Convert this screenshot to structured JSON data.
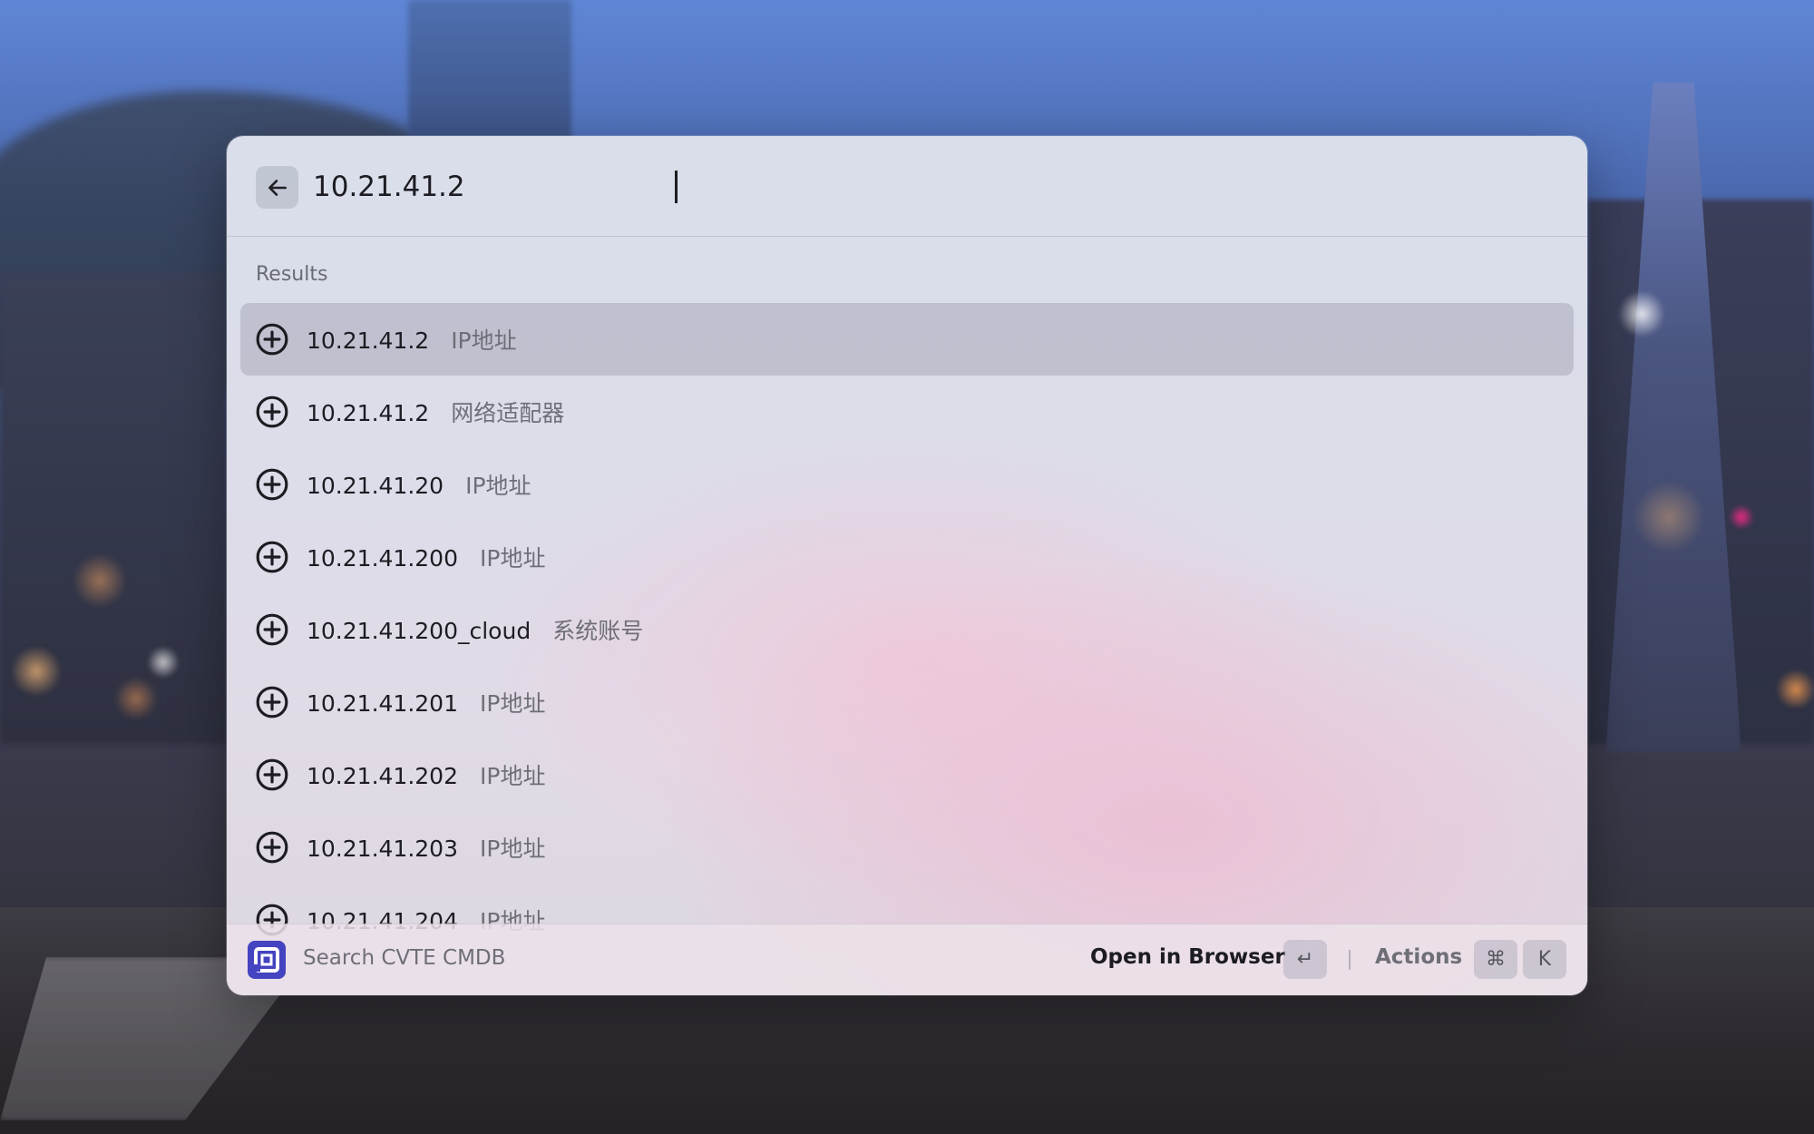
{
  "search": {
    "value": "10.21.41.2"
  },
  "results": {
    "section_title": "Results",
    "items": [
      {
        "title": "10.21.41.2",
        "subtitle": "IP地址",
        "selected": true
      },
      {
        "title": "10.21.41.2",
        "subtitle": "网络适配器"
      },
      {
        "title": "10.21.41.20",
        "subtitle": "IP地址"
      },
      {
        "title": "10.21.41.200",
        "subtitle": "IP地址"
      },
      {
        "title": "10.21.41.200_cloud",
        "subtitle": "系统账号"
      },
      {
        "title": "10.21.41.201",
        "subtitle": "IP地址"
      },
      {
        "title": "10.21.41.202",
        "subtitle": "IP地址"
      },
      {
        "title": "10.21.41.203",
        "subtitle": "IP地址"
      },
      {
        "title": "10.21.41.204",
        "subtitle": "IP地址"
      }
    ],
    "item_icon": "plus-circle-icon"
  },
  "footer": {
    "extension_title": "Search CVTE CMDB",
    "primary_action": "Open in Browser",
    "primary_shortcut": "↵",
    "actions_label": "Actions",
    "actions_shortcut": [
      "⌘",
      "K"
    ]
  },
  "colors": {
    "logo": "#4443c0",
    "selected_row": "#c3c3d1"
  }
}
